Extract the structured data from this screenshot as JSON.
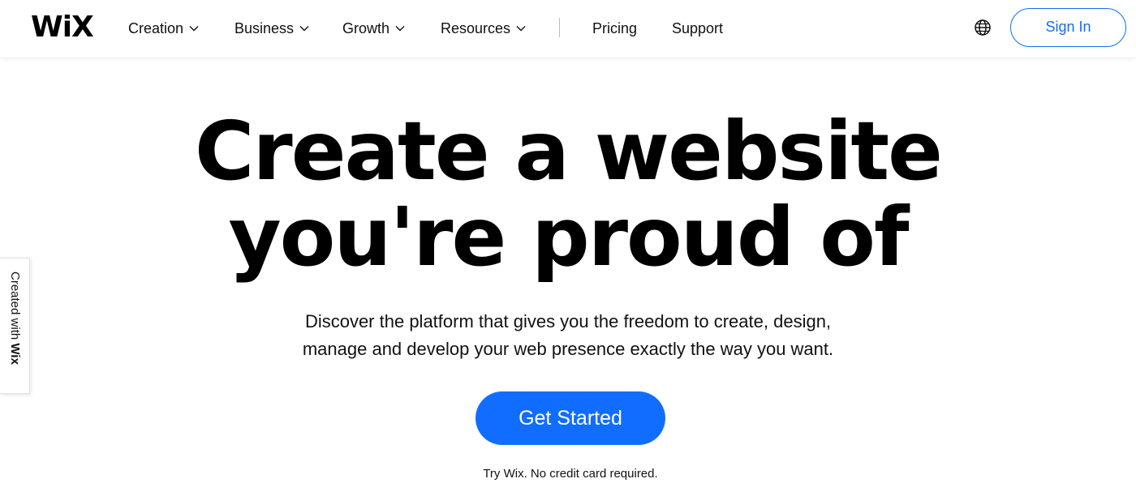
{
  "header": {
    "logo": "WiX",
    "nav": [
      {
        "label": "Creation",
        "has_dropdown": true
      },
      {
        "label": "Business",
        "has_dropdown": true
      },
      {
        "label": "Growth",
        "has_dropdown": true
      },
      {
        "label": "Resources",
        "has_dropdown": true
      },
      {
        "label": "Pricing",
        "has_dropdown": false
      },
      {
        "label": "Support",
        "has_dropdown": false
      }
    ],
    "globe_icon": "globe-icon",
    "sign_in_label": "Sign In"
  },
  "hero": {
    "title_line1": "Create a website",
    "title_line2": "you're proud of",
    "subtitle_line1": "Discover the platform that gives you the freedom to create, design,",
    "subtitle_line2": "manage and develop your web presence exactly the way you want.",
    "cta_label": "Get Started",
    "note": "Try Wix. No credit card required."
  },
  "side_badge": {
    "prefix": "Created with ",
    "brand": "Wix"
  },
  "colors": {
    "accent": "#116dff",
    "text": "#000000",
    "background": "#ffffff"
  }
}
